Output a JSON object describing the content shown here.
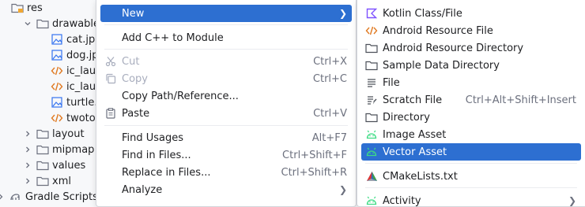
{
  "tree": {
    "rows": [
      {
        "label": "res"
      },
      {
        "label": "drawable"
      },
      {
        "label": "cat.jpg"
      },
      {
        "label": "dog.jpg"
      },
      {
        "label": "ic_laun"
      },
      {
        "label": "ic_laun"
      },
      {
        "label": "turtle."
      },
      {
        "label": "twoto"
      },
      {
        "label": "layout"
      },
      {
        "label": "mipmap"
      },
      {
        "label": "values"
      },
      {
        "label": "xml"
      },
      {
        "label": "Gradle Scripts"
      }
    ]
  },
  "context_menu": {
    "items": [
      {
        "label": "New",
        "selected": true
      },
      {
        "label": "Add C++ to Module"
      },
      {
        "label": "Cut",
        "shortcut": "Ctrl+X",
        "disabled": true
      },
      {
        "label": "Copy",
        "shortcut": "Ctrl+C",
        "disabled": true
      },
      {
        "label": "Copy Path/Reference..."
      },
      {
        "label": "Paste",
        "shortcut": "Ctrl+V"
      },
      {
        "label": "Find Usages",
        "shortcut": "Alt+F7"
      },
      {
        "label": "Find in Files...",
        "shortcut": "Ctrl+Shift+F"
      },
      {
        "label": "Replace in Files...",
        "shortcut": "Ctrl+Shift+R"
      },
      {
        "label": "Analyze"
      }
    ]
  },
  "new_submenu": {
    "items": [
      {
        "label": "Kotlin Class/File",
        "icon": "kotlin-icon"
      },
      {
        "label": "Android Resource File",
        "icon": "xml-resource-icon"
      },
      {
        "label": "Android Resource Directory",
        "icon": "folder-icon"
      },
      {
        "label": "Sample Data Directory",
        "icon": "folder-icon"
      },
      {
        "label": "File",
        "icon": "file-lines-icon"
      },
      {
        "label": "Scratch File",
        "icon": "scratch-file-icon",
        "shortcut": "Ctrl+Alt+Shift+Insert"
      },
      {
        "label": "Directory",
        "icon": "folder-icon"
      },
      {
        "label": "Image Asset",
        "icon": "android-icon"
      },
      {
        "label": "Vector Asset",
        "icon": "android-icon",
        "selected": true
      },
      {
        "label": "CMakeLists.txt",
        "icon": "cmake-icon"
      },
      {
        "label": "Activity",
        "icon": "android-icon"
      }
    ]
  },
  "colors": {
    "selection": "#2d6fd1",
    "menu_bg": "#ffffff",
    "tree_bg": "#f7f8fa",
    "disabled_text": "#a8adbd",
    "shortcut_text": "#6c707e",
    "android_green": "#3ddc84",
    "kotlin_purple": "#7f52ff",
    "xml_orange": "#e07a22",
    "image_blue": "#3574f0"
  }
}
